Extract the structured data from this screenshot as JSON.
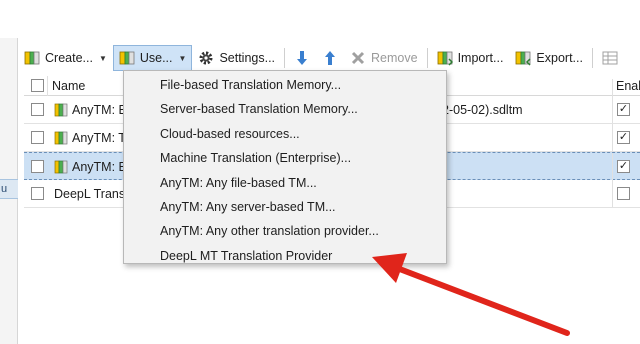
{
  "toolbar": {
    "create_label": "Create...",
    "use_label": "Use...",
    "settings_label": "Settings...",
    "remove_label": "Remove",
    "import_label": "Import...",
    "export_label": "Export..."
  },
  "grid": {
    "headers": {
      "name": "Name",
      "enabled": "Enab"
    },
    "rows": [
      {
        "name": "AnyTM: E",
        "path": "2-05-02).sdltm",
        "enabled": true
      },
      {
        "name": "AnyTM: T",
        "path": "",
        "enabled": true
      },
      {
        "name": "AnyTM: B",
        "path": "",
        "enabled": true
      },
      {
        "name": "DeepL Trans",
        "path": "",
        "enabled": false
      }
    ]
  },
  "left_panel": {
    "selected_text": "u"
  },
  "menu": {
    "items": [
      "File-based Translation Memory...",
      "Server-based Translation Memory...",
      "Cloud-based resources...",
      "Machine Translation (Enterprise)...",
      "AnyTM: Any file-based TM...",
      "AnyTM: Any server-based TM...",
      "AnyTM: Any other translation provider...",
      "DeepL MT Translation Provider"
    ]
  },
  "colors": {
    "annotation_arrow": "#e0251b",
    "selection": "#cce0f4",
    "active_button": "#cfe3f7"
  }
}
